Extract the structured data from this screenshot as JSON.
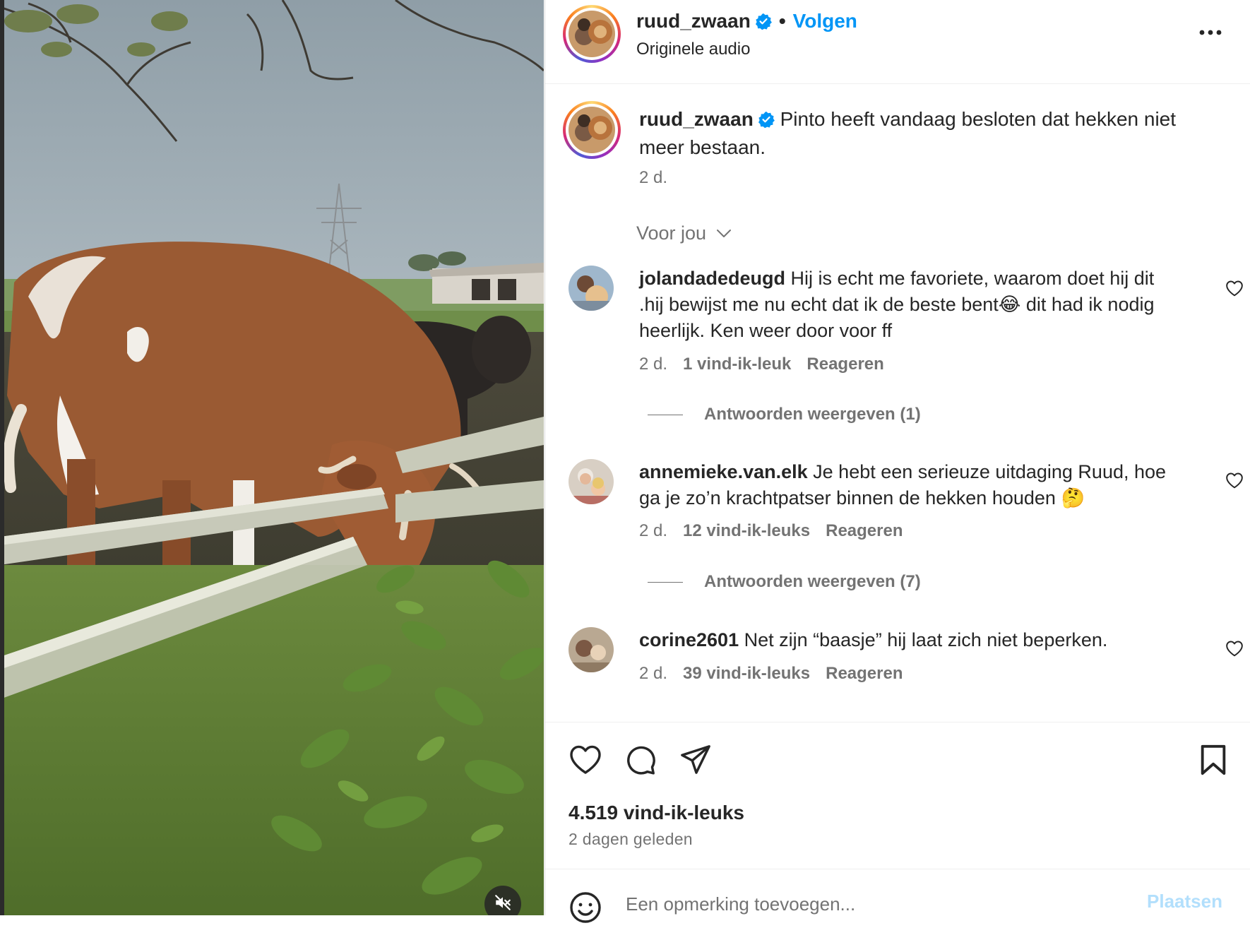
{
  "post": {
    "username": "ruud_zwaan",
    "follow_label": "Volgen",
    "audio_label": "Originele audio",
    "caption": "Pinto heeft vandaag besloten dat hekken niet meer bestaan.",
    "caption_time": "2 d."
  },
  "comments_sort": "Voor jou",
  "comments": [
    {
      "username": "jolandadedeugd",
      "text_before_emoji": "Hij is echt me favoriete, waarom doet hij dit .hij bewijst me nu echt dat ik de beste bent",
      "emoji": "😂",
      "text_after_emoji": " dit had ik nodig heerlijk. Ken weer door voor ff",
      "time": "2 d.",
      "likes": "1 vind-ik-leuk",
      "reply_label": "Reageren",
      "view_replies": "Antwoorden weergeven (1)"
    },
    {
      "username": "annemieke.van.elk",
      "text_before_emoji": "Je hebt een serieuze uitdaging Ruud, hoe ga je zo’n krachtpatser binnen de hekken houden",
      "emoji": "🤔",
      "text_after_emoji": "",
      "time": "2 d.",
      "likes": "12 vind-ik-leuks",
      "reply_label": "Reageren",
      "view_replies": "Antwoorden weergeven (7)"
    },
    {
      "username": "corine2601",
      "text_before_emoji": "Net zijn “baasje” hij laat zich niet beperken.",
      "emoji": "",
      "text_after_emoji": "",
      "time": "2 d.",
      "likes": "39 vind-ik-leuks",
      "reply_label": "Reageren",
      "view_replies": ""
    }
  ],
  "stats": {
    "likes": "4.519 vind-ik-leuks",
    "posted": "2 dagen geleden"
  },
  "composer": {
    "placeholder": "Een opmerking toevoegen...",
    "post_label": "Plaatsen"
  },
  "icons": {
    "verified": "verified-badge-icon",
    "more": "more-options-icon",
    "chevron": "chevron-down-icon",
    "like": "heart-icon",
    "comment": "comment-icon",
    "share": "share-icon",
    "save": "bookmark-icon",
    "emoji": "emoji-icon",
    "mute": "speaker-muted-icon"
  },
  "colors": {
    "accent": "#0095f6",
    "verified": "#0095f6",
    "secondary_text": "#737373",
    "post_disabled": "#b2dffc"
  }
}
